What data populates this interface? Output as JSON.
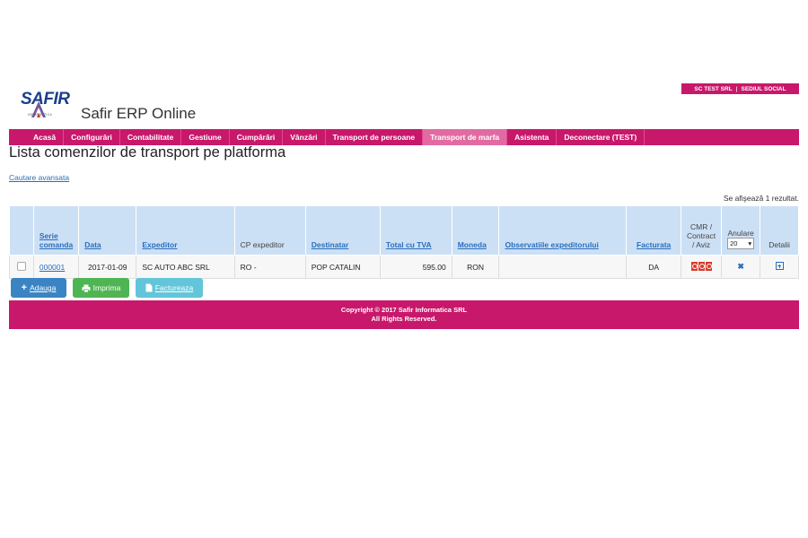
{
  "top_bar": {
    "company": "SC TEST SRL",
    "separator": "|",
    "location": "SEDIUL SOCIAL"
  },
  "logo": {
    "text": "SAFIR",
    "subtext": "INFORMATICA"
  },
  "app_title": "Safir ERP Online",
  "nav": [
    {
      "label": "Acasă"
    },
    {
      "label": "Configurări"
    },
    {
      "label": "Contabilitate"
    },
    {
      "label": "Gestiune"
    },
    {
      "label": "Cumpărări"
    },
    {
      "label": "Vânzări"
    },
    {
      "label": "Transport de persoane"
    },
    {
      "label": "Transport de marfa",
      "active": true
    },
    {
      "label": "Asistenta"
    },
    {
      "label": "Deconectare (TEST)"
    }
  ],
  "page_title": "Lista comenzilor de transport pe platforma",
  "advanced_search": "Cautare avansata",
  "results_summary": "Se afişează 1 rezultat.",
  "table": {
    "headers": {
      "serie": "Serie comanda",
      "data": "Data",
      "expeditor": "Expeditor",
      "cp_expeditor": "CP expeditor",
      "destinatar": "Destinatar",
      "total": "Total cu TVA",
      "moneda": "Moneda",
      "observatii": "Observatiile expeditorului",
      "facturata": "Facturata",
      "docs": "CMR / Contract / Aviz",
      "anulare": "Anulare",
      "page_size": "20",
      "detalii": "Detalii"
    },
    "rows": [
      {
        "serie": "000001",
        "data": "2017-01-09",
        "expeditor": "SC AUTO ABC SRL",
        "cp_expeditor": "RO -",
        "destinatar": "POP CATALIN",
        "total": "595.00",
        "moneda": "RON",
        "observatii": "",
        "facturata": "DA"
      }
    ]
  },
  "buttons": {
    "add": "Adauga",
    "print": "Imprima",
    "invoice": "Factureaza"
  },
  "footer": {
    "line1": "Copyright © 2017 Safir Informatica SRL",
    "line2": "All Rights Reserved."
  },
  "colors": {
    "brand": "#c8186b",
    "nav_active": "#e26aa3",
    "header_bg": "#cce0f5",
    "link": "#2a6ebb",
    "btn_add": "#3b84c4",
    "btn_print": "#4fb553",
    "btn_invoice": "#63c5d9"
  },
  "icons": {
    "pdf": "pdf-file-icon",
    "cancel": "x-icon",
    "details": "plus-square-icon",
    "add": "plus-icon",
    "print": "printer-icon",
    "invoice": "document-icon"
  }
}
